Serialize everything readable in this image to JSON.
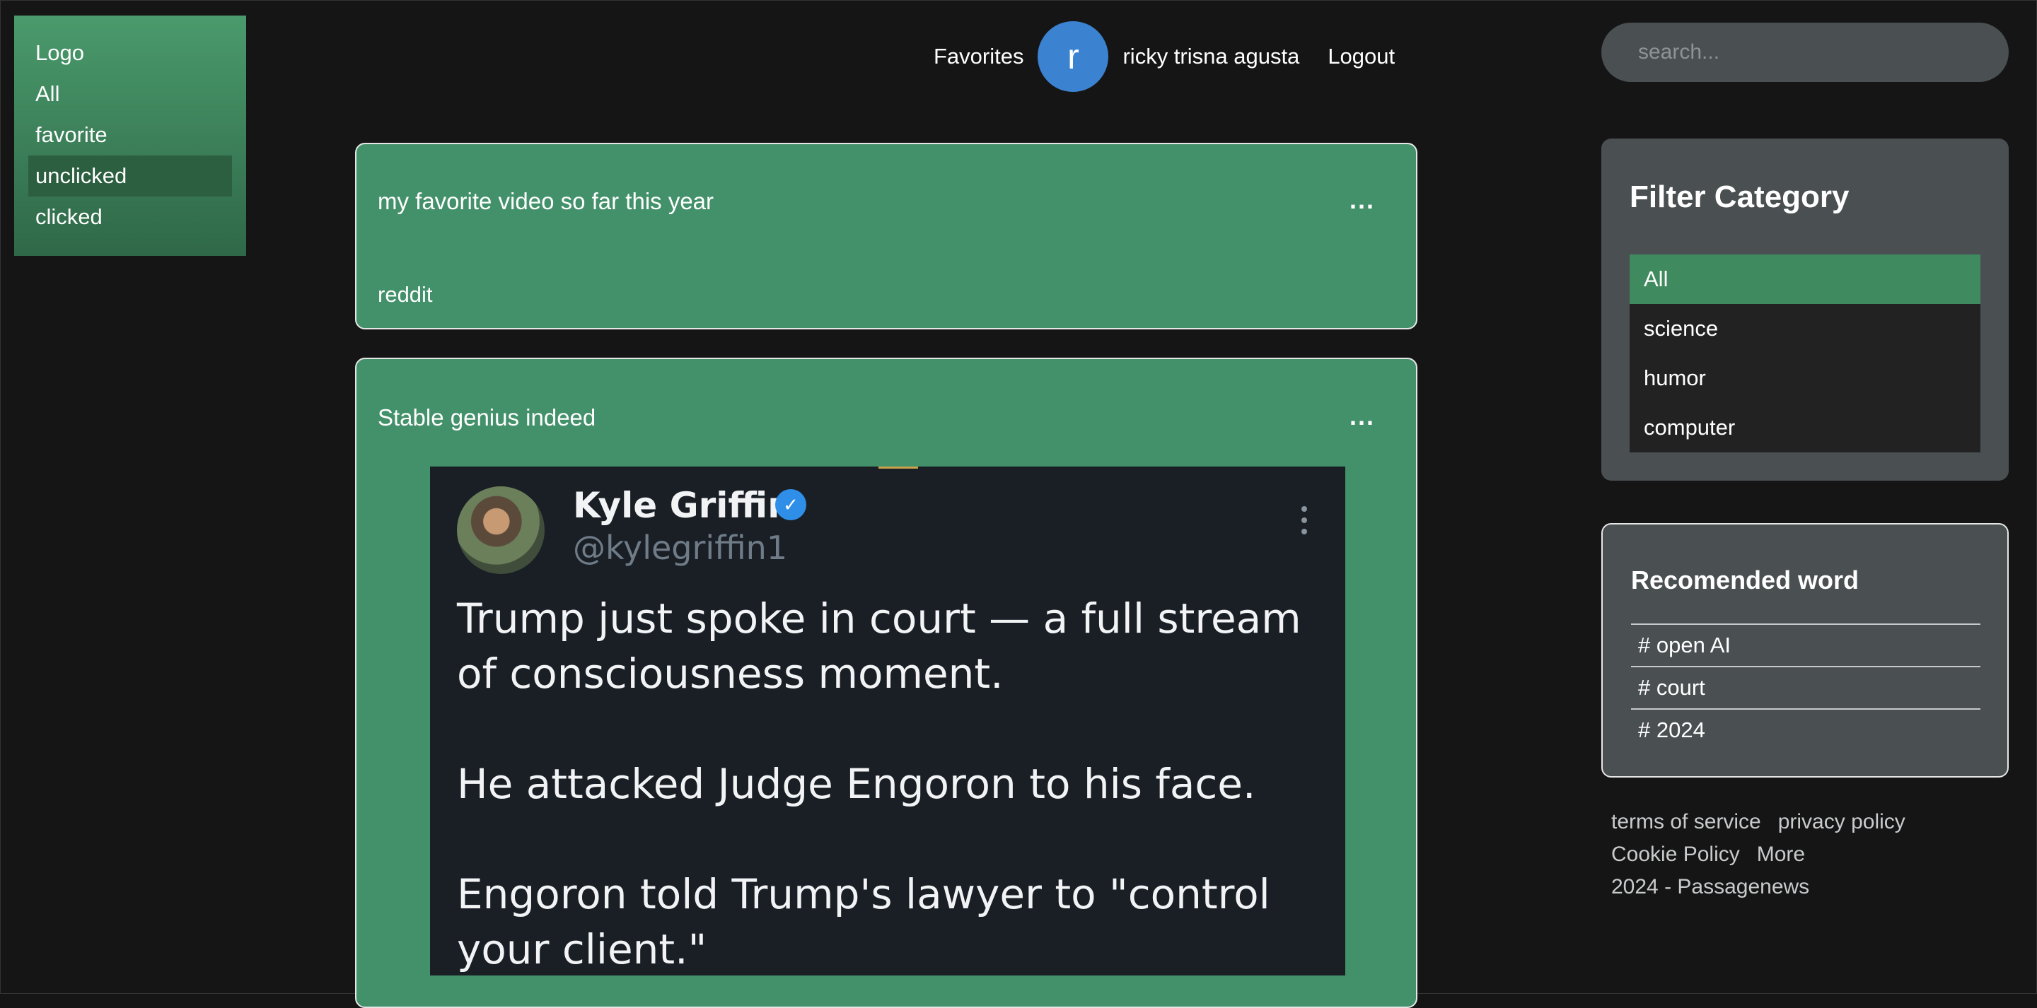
{
  "sidebar": {
    "items": [
      {
        "label": "Logo"
      },
      {
        "label": "All"
      },
      {
        "label": "favorite"
      },
      {
        "label": "unclicked"
      },
      {
        "label": "clicked"
      }
    ]
  },
  "header": {
    "favorites": "Favorites",
    "avatar_initial": "r",
    "username": "ricky trisna agusta",
    "logout": "Logout"
  },
  "search": {
    "placeholder": "search..."
  },
  "posts": [
    {
      "title": "my favorite video so far this year",
      "menu": "...",
      "source": "reddit"
    },
    {
      "title": "Stable genius indeed",
      "menu": "...",
      "tweet": {
        "name": "Kyle Griffin",
        "verified_mark": "✓",
        "handle": "@kylegriffin1",
        "paragraphs": [
          "Trump just spoke in court — a full stream of consciousness moment.",
          "He attacked Judge Engoron to his face.",
          "Engoron told Trump's lawyer to \"control your client.\""
        ]
      }
    }
  ],
  "filter": {
    "title": "Filter Category",
    "items": [
      {
        "label": "All"
      },
      {
        "label": "science"
      },
      {
        "label": "humor"
      },
      {
        "label": "computer"
      }
    ]
  },
  "recommended": {
    "title": "Recomended word",
    "items": [
      {
        "label": "# open AI"
      },
      {
        "label": "# court"
      },
      {
        "label": "# 2024"
      }
    ]
  },
  "footer": {
    "terms": "terms of service",
    "privacy": "privacy policy",
    "cookie": "Cookie Policy",
    "more": "More",
    "copyright": "2024 - Passagenews"
  },
  "colors": {
    "background": "#151515",
    "accent_green": "#43916a",
    "avatar_blue": "#3b82d0",
    "panel_gray": "#4a4f52"
  }
}
